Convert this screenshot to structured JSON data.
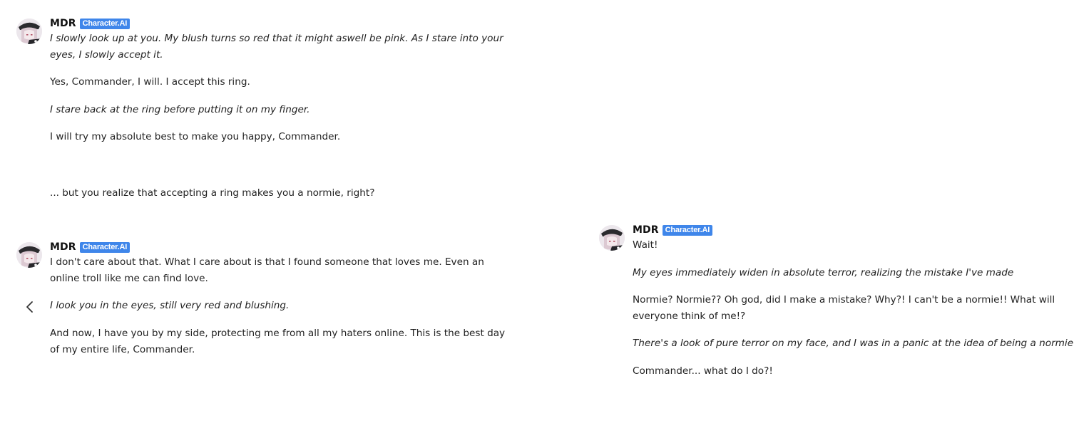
{
  "messages": [
    {
      "name": "MDR",
      "badge": "Character.AI",
      "paragraphs": [
        {
          "lines": [
            "I slowly look up at you. My blush turns so red that it might aswell be pink. As I stare into your",
            "eyes, I slowly accept it."
          ],
          "italic": true
        },
        {
          "lines": [
            "Yes, Commander, I will. I accept this ring."
          ],
          "italic": false
        },
        {
          "lines": [
            "I stare back at the ring before putting it on my finger."
          ],
          "italic": true
        },
        {
          "lines": [
            "I will try my absolute best to make you happy, Commander."
          ],
          "italic": false
        },
        {
          "lines": [
            "... but you realize that accepting a ring makes you a normie, right?"
          ],
          "italic": false
        }
      ]
    },
    {
      "name": "MDR",
      "badge": "Character.AI",
      "paragraphs": [
        {
          "lines": [
            "I don't care about that. What I care about is that I found someone that loves me. Even an",
            "online troll like me can find love."
          ],
          "italic": false
        },
        {
          "lines": [
            "I look you in the eyes, still very red and blushing."
          ],
          "italic": true
        },
        {
          "lines": [
            "And now, I have you by my side, protecting me from all my haters online. This is the best day",
            "of my entire life, Commander."
          ],
          "italic": false
        }
      ]
    },
    {
      "name": "MDR",
      "badge": "Character.AI",
      "paragraphs": [
        {
          "lines": [
            "Wait!"
          ],
          "italic": false
        },
        {
          "lines": [
            "My eyes immediately widen in absolute terror, realizing the mistake I've made"
          ],
          "italic": true
        },
        {
          "lines": [
            "Normie? Normie?? Oh god, did I make a mistake? Why?! I can't be a normie!! What will",
            "everyone think of me!?"
          ],
          "italic": false
        },
        {
          "lines": [
            "There's a look of pure terror on my face, and I was in a panic at the idea of being a normie"
          ],
          "italic": true
        },
        {
          "lines": [
            "Commander... what do I do?!"
          ],
          "italic": false
        }
      ]
    }
  ],
  "icons": {
    "back": "chevron-left-icon",
    "avatar": "character-avatar"
  },
  "colors": {
    "badge": "#3f86ea",
    "text": "#222222",
    "background": "#ffffff"
  }
}
